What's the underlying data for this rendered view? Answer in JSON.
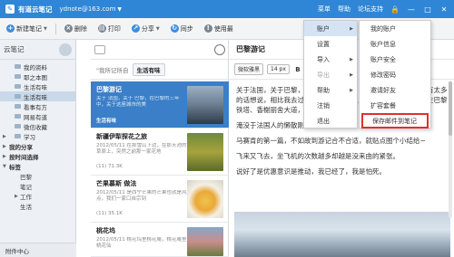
{
  "titlebar": {
    "app_name": "有道云笔记",
    "user": "ydnote@163.com",
    "menus": [
      "菜单",
      "帮助",
      "论坛支持"
    ],
    "window_buttons": [
      "🔒",
      "—",
      "□",
      "✕"
    ]
  },
  "toolbar": {
    "new_note": "新建笔记",
    "delete": "删除",
    "print": "打印",
    "share": "分享",
    "sync": "同步",
    "use_tip": "使用最"
  },
  "sidebar": {
    "header": "云笔记",
    "items": [
      {
        "label": "我的资料",
        "level": 2
      },
      {
        "label": "耶之本图",
        "level": 2
      },
      {
        "label": "生活有味",
        "level": 2
      },
      {
        "label": "生活有味",
        "level": 2,
        "selected": true
      },
      {
        "label": "看事有方",
        "level": 2
      },
      {
        "label": "网易有道",
        "level": 2
      },
      {
        "label": "微信收藏",
        "level": 2
      },
      {
        "label": "学习",
        "level": 2
      },
      {
        "label": "我的分享",
        "level": 1
      },
      {
        "label": "按时间选择",
        "level": 1
      },
      {
        "label": "标签",
        "level": 1
      },
      {
        "label": "巴黎",
        "level": 3
      },
      {
        "label": "笔记",
        "level": 3
      },
      {
        "label": "工作",
        "level": 3
      },
      {
        "label": "生活",
        "level": 3
      }
    ],
    "bottom": "附件中心"
  },
  "notelist": {
    "crumb_prev": "\"我所记所自",
    "crumb_current": "生活有味",
    "notes": [
      {
        "title": "巴黎游记",
        "desc": "关于 法国，关于 巴黎，在巴黎的三年中，关于这座城市的美",
        "meta": "生活有味",
        "selected": true
      },
      {
        "title": "新疆伊犁探花之旅",
        "desc": "2012/05/11 在那雪山下边，在那天池的草原上，突然之前那一家花地",
        "meta": "(11) 71.3K"
      },
      {
        "title": "芒果慕斯 做法",
        "desc": "2012/05/11 是西宁芒果的芒果也就是风点，我们一家口自宗到",
        "meta": "(11) 35.1K"
      },
      {
        "title": "桃花坞",
        "desc": "2012/05/11 桃花坞里桃花庵，桃花庵里桃花仙",
        "meta": ""
      }
    ]
  },
  "editor": {
    "title": "巴黎游记",
    "font_family": "微软雅黑",
    "font_size": "14 px",
    "paragraphs": [
      "关于法国，关于巴黎，在巴黎的三年中，关于这座城市的美总是有太多的话想说，相比我去过的其他城市，这里有着一种独特的魅力，在巴黎铁塔、香榭丽舍大道，在国外的...",
      "淹没于法国人的懒散刚随性笔~",
      "马赛肯的第一篇，不如故到游记合不合适，就贴点图个小结给~",
      "飞来又飞去，坐飞机的次数越多却越是没来由的紧张。",
      "说好了是优惠意识是推动，我已经了，我是怕死。"
    ]
  },
  "menu_account": {
    "items": [
      {
        "label": "账户",
        "submenu": true,
        "highlighted": true
      },
      {
        "label": "设置"
      },
      {
        "label": "导入",
        "submenu": true
      },
      {
        "label": "导出",
        "submenu": true,
        "disabled": true
      },
      {
        "label": "帮助",
        "submenu": true
      },
      {
        "label": "注销"
      },
      {
        "label": "退出"
      }
    ]
  },
  "menu_account_sub": {
    "items": [
      {
        "label": "我的账户"
      },
      {
        "label": "账户信息"
      },
      {
        "label": "账户安全"
      },
      {
        "label": "修改密码"
      },
      {
        "label": "邀请好友"
      },
      {
        "label": "扩容套餐"
      },
      {
        "label": "保存邮件到笔记",
        "boxed": true
      }
    ]
  },
  "colors": {
    "brand": "#2f86d6",
    "selected_note": "#3a7fc8",
    "highlight_box": "#e0302a"
  }
}
